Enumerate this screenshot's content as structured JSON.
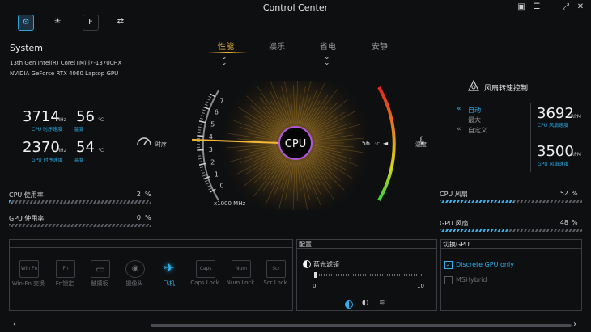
{
  "window": {
    "title": "Control Center",
    "buttons": [
      "▣",
      "☰",
      "⤢",
      "✕"
    ]
  },
  "top_icons": [
    {
      "name": "dashboard-icon",
      "glyph": "⚙",
      "active": true
    },
    {
      "name": "brightness-icon",
      "glyph": "☀"
    },
    {
      "name": "function-key-icon",
      "glyph": "F"
    },
    {
      "name": "connection-icon",
      "glyph": "⇄"
    }
  ],
  "system": {
    "heading": "System",
    "cpu_model": "13th Gen Intel(R) Core(TM) i7-13700HX",
    "gpu_model": "NVIDIA GeForce RTX 4060 Laptop GPU",
    "cpu_freq": "3714",
    "cpu_freq_unit": "MHz",
    "cpu_freq_label": "CPU 时序速度",
    "cpu_temp": "56",
    "cpu_temp_unit": "°C",
    "cpu_temp_label": "温度",
    "gpu_freq": "2370",
    "gpu_freq_unit": "MHz",
    "gpu_freq_label": "GPU 时序速度",
    "gpu_temp": "54",
    "gpu_temp_unit": "°C",
    "gpu_temp_label": "温度",
    "clock_label": "时序",
    "cpu_usage_label": "CPU 使用率",
    "cpu_usage_value": "2",
    "cpu_usage_unit": "%",
    "cpu_usage_fraction": 0.02,
    "gpu_usage_label": "GPU 使用率",
    "gpu_usage_value": "0",
    "gpu_usage_unit": "%",
    "gpu_usage_fraction": 0.0
  },
  "modes": {
    "tabs": [
      "性能",
      "娱乐",
      "省电",
      "安静"
    ],
    "active_index": 0
  },
  "gauge": {
    "center_label": "CPU",
    "ticks": [
      "0",
      "1",
      "2",
      "3",
      "4",
      "5",
      "6",
      "7"
    ],
    "unit": "x1000 MHz",
    "value": 3.714,
    "temp_value": "56",
    "temp_unit": "°C",
    "temp_label": "温度"
  },
  "fan": {
    "heading": "风扇转速控制",
    "modes": [
      "自动",
      "最大",
      "自定义"
    ],
    "active_mode": 0,
    "cpu_rpm": "3692",
    "cpu_rpm_unit": "RPM",
    "cpu_rpm_label": "CPU 风扇速度",
    "gpu_rpm": "3500",
    "gpu_rpm_unit": "RPM",
    "gpu_rpm_label": "GPU 风扇速度",
    "cpu_fan_label": "CPU 风扇",
    "cpu_fan_value": "52",
    "cpu_fan_unit": "%",
    "cpu_fan_fraction": 0.52,
    "gpu_fan_label": "GPU 风扇",
    "gpu_fan_value": "48",
    "gpu_fan_unit": "%",
    "gpu_fan_fraction": 0.48
  },
  "keys": [
    {
      "icon": "Win Fn",
      "label": "Win-Fn 交换"
    },
    {
      "icon": "Fn",
      "label": "Fn锁定"
    },
    {
      "icon": "▭",
      "label": "触摸板"
    },
    {
      "icon": "◉",
      "label": "摄像头"
    },
    {
      "icon": "✈",
      "label": "飞机"
    },
    {
      "icon": "Caps",
      "label": "Caps Lock"
    },
    {
      "icon": "Num",
      "label": "Num Lock"
    },
    {
      "icon": "Scr",
      "label": "Scr Lock"
    }
  ],
  "config": {
    "heading": "配置",
    "filter_label": "蓝光滤镜",
    "slider_min": "0",
    "slider_max": "10",
    "slider_value": 0
  },
  "gpu_switch": {
    "heading": "切换GPU",
    "option1": "Discrete GPU only",
    "option1_checked": true,
    "option2": "MSHybrid",
    "option2_checked": false
  },
  "colors": {
    "accent": "#2fb0ea",
    "performance": "#f5b83a"
  }
}
